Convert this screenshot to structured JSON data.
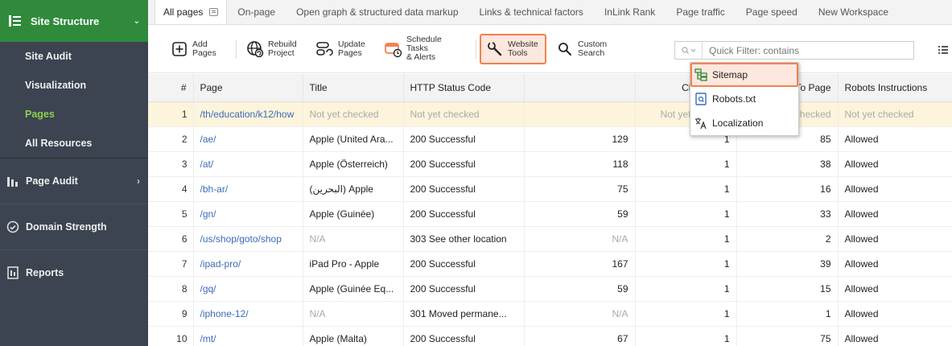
{
  "colors": {
    "accent_green": "#2f8a3c",
    "active_nav": "#8ed04a",
    "highlight": "#f0824f",
    "link": "#3b6cb7",
    "sidebar_bg": "#3b4450"
  },
  "sidebar": {
    "header": {
      "label": "Site Structure",
      "icon": "site-structure-icon"
    },
    "subitems": [
      {
        "label": "Site Audit",
        "active": false
      },
      {
        "label": "Visualization",
        "active": false
      },
      {
        "label": "Pages",
        "active": true
      },
      {
        "label": "All Resources",
        "active": false
      }
    ],
    "sections": [
      {
        "label": "Page Audit",
        "icon": "page-audit-icon",
        "chevron": "›"
      },
      {
        "label": "Domain Strength",
        "icon": "gauge-icon",
        "chevron": ""
      },
      {
        "label": "Reports",
        "icon": "reports-icon",
        "chevron": ""
      }
    ]
  },
  "tabs": [
    {
      "label": "All pages",
      "active": true
    },
    {
      "label": "On-page"
    },
    {
      "label": "Open graph & structured data markup"
    },
    {
      "label": "Links & technical factors"
    },
    {
      "label": "InLink Rank"
    },
    {
      "label": "Page traffic"
    },
    {
      "label": "Page speed"
    },
    {
      "label": "New Workspace"
    }
  ],
  "toolbar": {
    "add": {
      "line1": "Add",
      "line2": "Pages"
    },
    "rebuild": {
      "line1": "Rebuild",
      "line2": "Project"
    },
    "update": {
      "line1": "Update",
      "line2": "Pages"
    },
    "schedule": {
      "line1": "Schedule Tasks",
      "line2": "& Alerts"
    },
    "website_tools": {
      "line1": "Website",
      "line2": "Tools"
    },
    "custom_search": {
      "line1": "Custom",
      "line2": "Search"
    },
    "filter_placeholder": "Quick Filter: contains"
  },
  "dropdown": {
    "items": [
      {
        "label": "Sitemap",
        "icon": "sitemap-icon"
      },
      {
        "label": "Robots.txt",
        "icon": "robots-icon"
      },
      {
        "label": "Localization",
        "icon": "localization-icon"
      }
    ]
  },
  "table": {
    "headers": {
      "num": "#",
      "page": "Page",
      "title": "Title",
      "status": "HTTP Status Code",
      "hidden": "",
      "click_depth": "Click depth",
      "links_to_page": "Links To Page",
      "robots": "Robots Instructions"
    },
    "rows": [
      {
        "n": "1",
        "page": "/th/education/k12/how",
        "title": "Not yet checked",
        "status": "Not yet checked",
        "hidden": "",
        "click_depth": "Not yet checked",
        "links_to_page": "Not yet checked",
        "robots": "Not yet checked"
      },
      {
        "n": "2",
        "page": "/ae/",
        "title": "Apple (United Ara...",
        "status": "200 Successful",
        "hidden": "129",
        "click_depth": "1",
        "links_to_page": "85",
        "robots": "Allowed"
      },
      {
        "n": "3",
        "page": "/at/",
        "title": "Apple (Österreich)",
        "status": "200 Successful",
        "hidden": "118",
        "click_depth": "1",
        "links_to_page": "38",
        "robots": "Allowed"
      },
      {
        "n": "4",
        "page": "/bh-ar/",
        "title": "(البحرين) Apple",
        "status": "200 Successful",
        "hidden": "75",
        "click_depth": "1",
        "links_to_page": "16",
        "robots": "Allowed"
      },
      {
        "n": "5",
        "page": "/gn/",
        "title": "Apple (Guinée)",
        "status": "200 Successful",
        "hidden": "59",
        "click_depth": "1",
        "links_to_page": "33",
        "robots": "Allowed"
      },
      {
        "n": "6",
        "page": "/us/shop/goto/shop",
        "title": "N/A",
        "status": "303 See other location",
        "hidden": "N/A",
        "click_depth": "1",
        "links_to_page": "2",
        "robots": "Allowed"
      },
      {
        "n": "7",
        "page": "/ipad-pro/",
        "title": "iPad Pro - Apple",
        "status": "200 Successful",
        "hidden": "167",
        "click_depth": "1",
        "links_to_page": "39",
        "robots": "Allowed"
      },
      {
        "n": "8",
        "page": "/gq/",
        "title": "Apple (Guinée Eq...",
        "status": "200 Successful",
        "hidden": "59",
        "click_depth": "1",
        "links_to_page": "15",
        "robots": "Allowed"
      },
      {
        "n": "9",
        "page": "/iphone-12/",
        "title": "N/A",
        "status": "301 Moved permane...",
        "hidden": "N/A",
        "click_depth": "1",
        "links_to_page": "1",
        "robots": "Allowed"
      },
      {
        "n": "10",
        "page": "/mt/",
        "title": "Apple (Malta)",
        "status": "200 Successful",
        "hidden": "67",
        "click_depth": "1",
        "links_to_page": "75",
        "robots": "Allowed"
      }
    ]
  }
}
